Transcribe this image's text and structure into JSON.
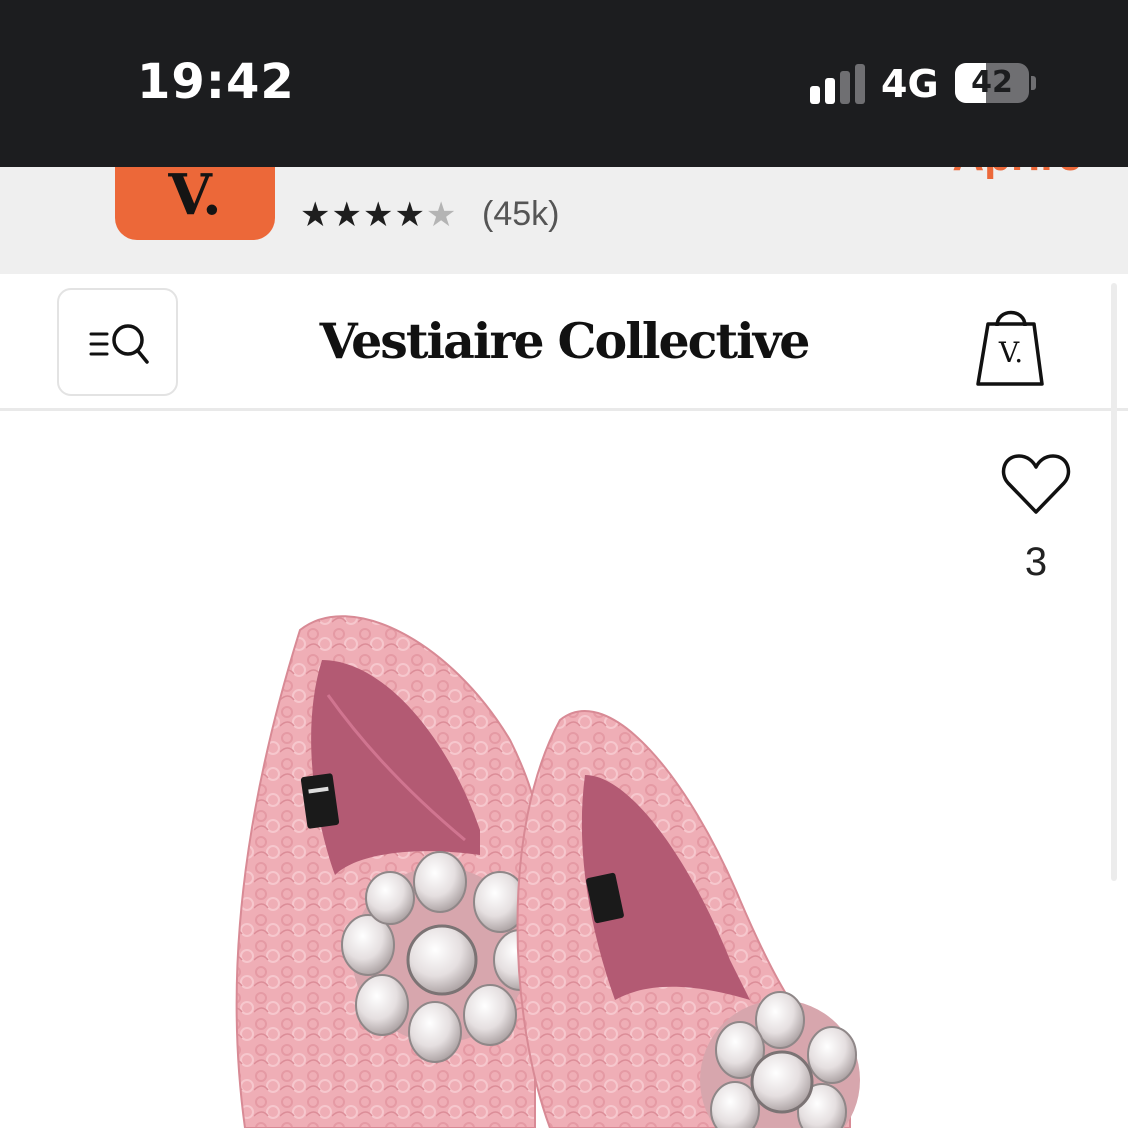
{
  "status_bar": {
    "time": "19:42",
    "network": "4G",
    "battery_level": "42",
    "battery_fraction": 0.42
  },
  "app_banner": {
    "logo_letter": "V.",
    "stars": "★★★★",
    "stars_half": "★",
    "reviews": "(45k)",
    "cta": "Apriré",
    "brand_color": "#ec6839"
  },
  "header": {
    "menu_icon": "menu-search-icon",
    "logo": "Vestiaire Collective",
    "bag_icon": "shopping-bag-icon",
    "bag_letter": "V."
  },
  "product": {
    "favorite_icon": "heart-outline-icon",
    "favorite_count": "3",
    "image": "pink lace loafers with crystal brooch"
  }
}
